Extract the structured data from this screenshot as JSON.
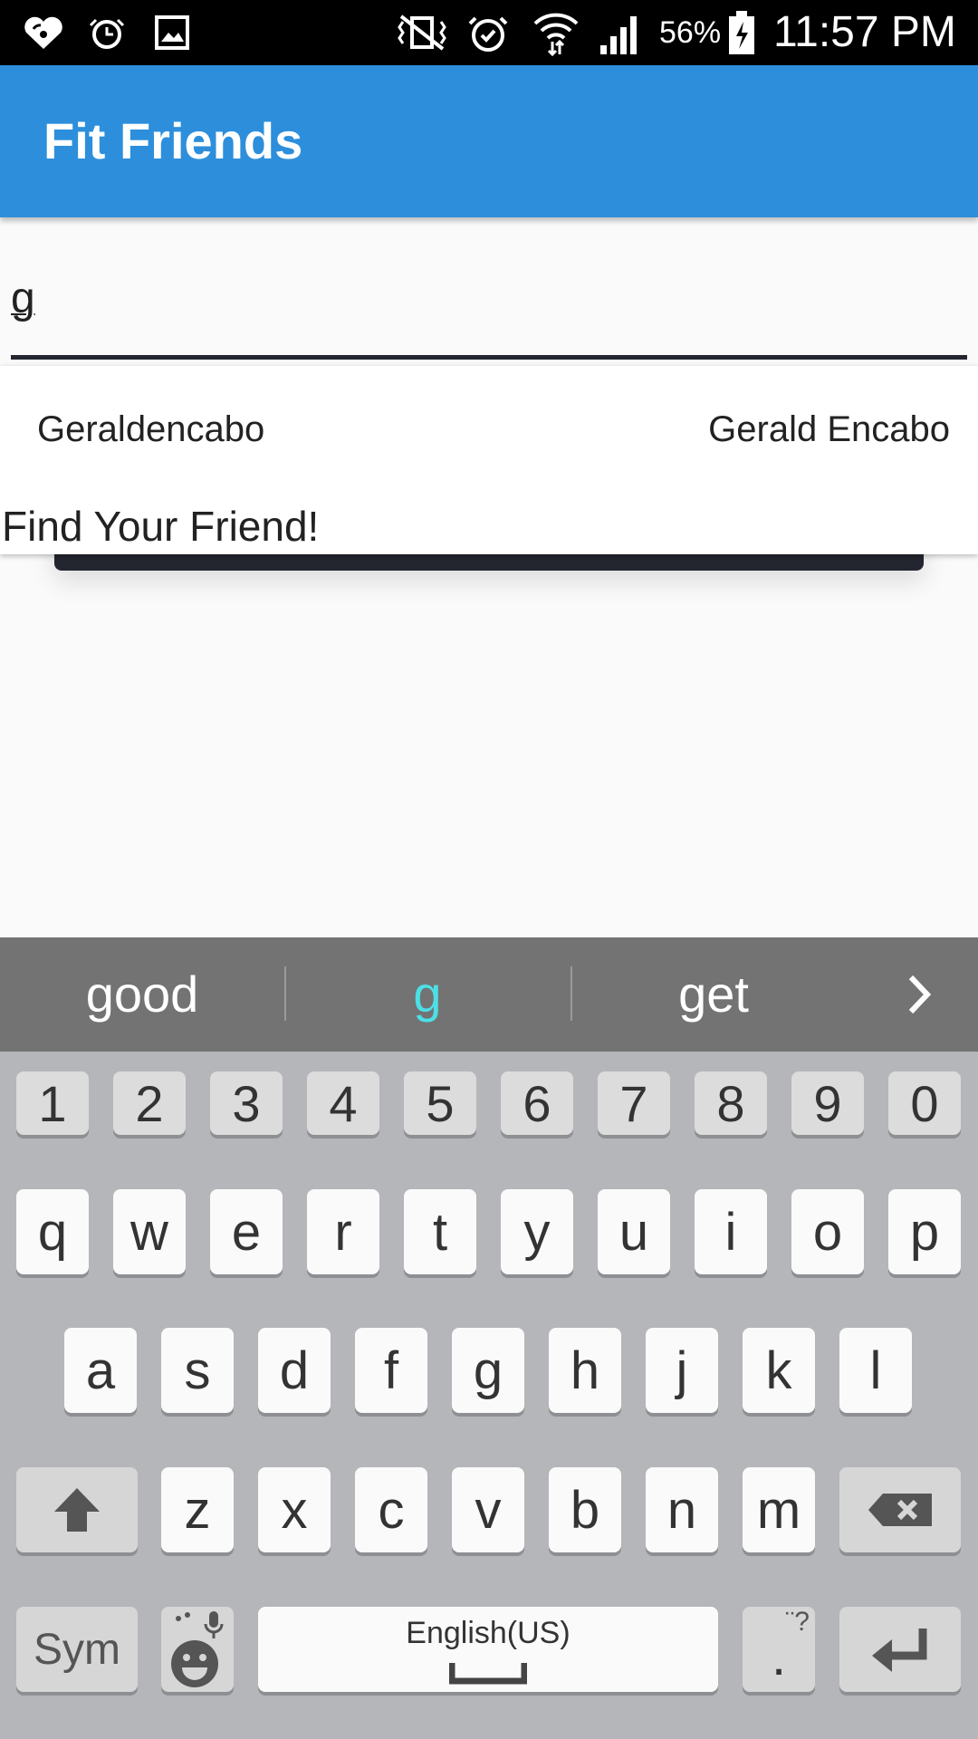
{
  "status_bar": {
    "battery": "56%",
    "time": "11:57 PM",
    "icons": [
      "iheartradio-icon",
      "alarm-clock-icon",
      "gallery-icon",
      "vibrate-mute-icon",
      "alarm-icon",
      "wifi-icon",
      "signal-icon",
      "battery-icon"
    ]
  },
  "app_bar": {
    "title": "Fit Friends",
    "background_color": "#2d8fdb"
  },
  "search": {
    "value": "g"
  },
  "suggestions": [
    {
      "username": "Geraldencabo",
      "full_name": "Gerald Encabo"
    }
  ],
  "find_label": "Find Your Friend!",
  "keyboard": {
    "predictions": [
      "good",
      "g",
      "get"
    ],
    "number_row": [
      "1",
      "2",
      "3",
      "4",
      "5",
      "6",
      "7",
      "8",
      "9",
      "0"
    ],
    "row1": [
      "q",
      "w",
      "e",
      "r",
      "t",
      "y",
      "u",
      "i",
      "o",
      "p"
    ],
    "row2": [
      "a",
      "s",
      "d",
      "f",
      "g",
      "h",
      "j",
      "k",
      "l"
    ],
    "row3": [
      "z",
      "x",
      "c",
      "v",
      "b",
      "n",
      "m"
    ],
    "sym_label": "Sym",
    "space_label": "English(US)",
    "period_label": ".",
    "highlight_color": "#4ddfe6"
  }
}
